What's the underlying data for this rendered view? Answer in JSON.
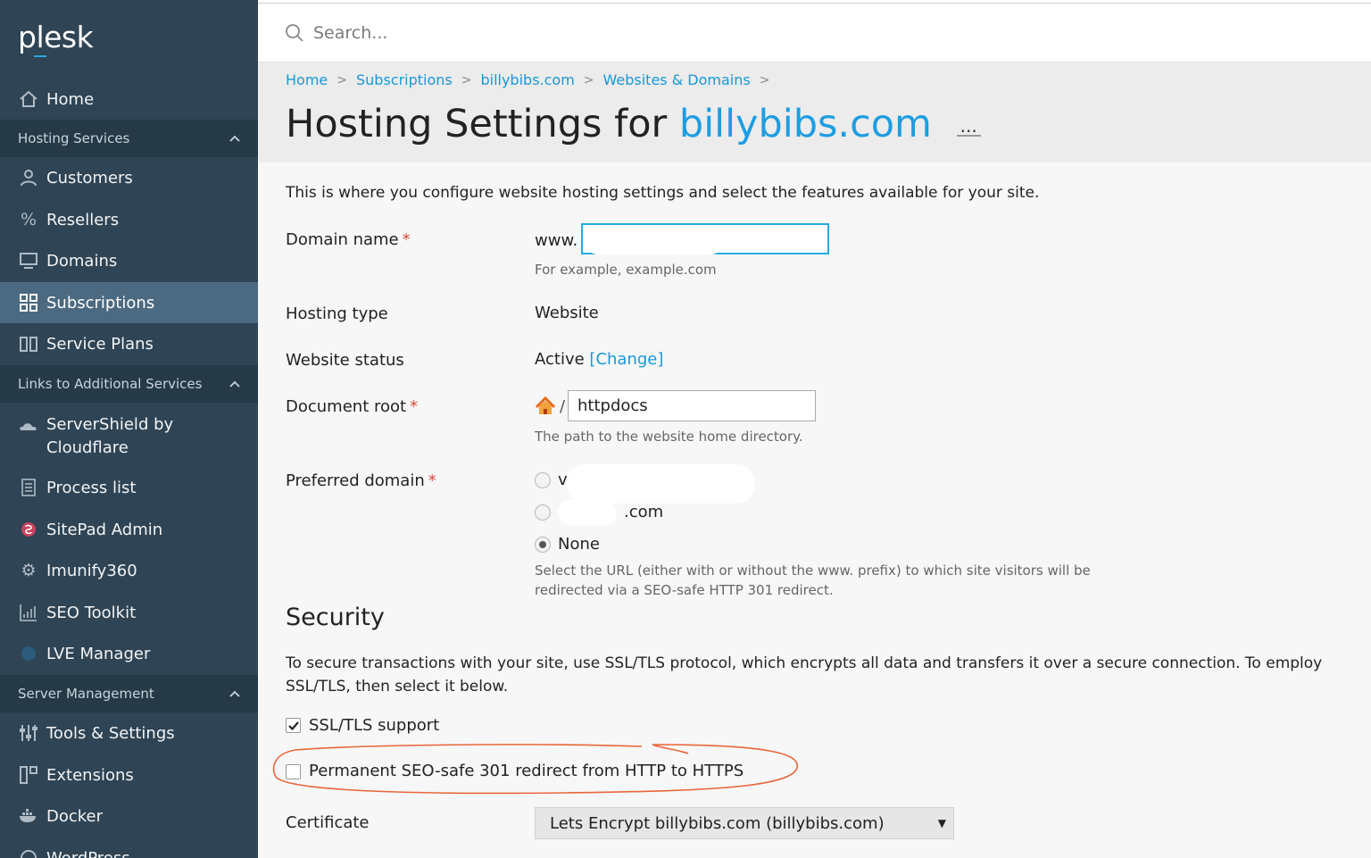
{
  "brand": {
    "logo_text": "plesk"
  },
  "sidebar": {
    "home": "Home",
    "sections": [
      {
        "label": "Hosting Services",
        "chevron": "^"
      },
      {
        "label": "Links to Additional Services",
        "chevron": "^"
      },
      {
        "label": "Server Management",
        "chevron": "^"
      }
    ],
    "hosting_items": [
      {
        "label": "Customers",
        "icon": "user-icon"
      },
      {
        "label": "Resellers",
        "icon": "percent-icon"
      },
      {
        "label": "Domains",
        "icon": "monitor-icon"
      },
      {
        "label": "Subscriptions",
        "icon": "grid-icon",
        "active": true
      },
      {
        "label": "Service Plans",
        "icon": "book-icon"
      }
    ],
    "additional_items": [
      {
        "label": "ServerShield by Cloudflare",
        "icon": "cloud-icon"
      },
      {
        "label": "Process list",
        "icon": "list-icon"
      },
      {
        "label": "SitePad Admin",
        "icon": "sitepad-icon"
      },
      {
        "label": "Imunify360",
        "icon": "gear-icon"
      },
      {
        "label": "SEO Toolkit",
        "icon": "chart-icon"
      },
      {
        "label": "LVE Manager",
        "icon": "lve-icon"
      }
    ],
    "server_items": [
      {
        "label": "Tools & Settings",
        "icon": "sliders-icon"
      },
      {
        "label": "Extensions",
        "icon": "extensions-icon"
      },
      {
        "label": "Docker",
        "icon": "docker-icon"
      },
      {
        "label": "WordPress",
        "icon": "wordpress-icon"
      }
    ]
  },
  "search": {
    "placeholder": "Search..."
  },
  "breadcrumb": [
    "Home",
    "Subscriptions",
    "billybibs.com",
    "Websites & Domains"
  ],
  "page": {
    "title_prefix": "Hosting Settings for",
    "title_domain": "billybibs.com",
    "more": "...",
    "intro": "This is where you configure website hosting settings and select the features available for your site."
  },
  "form": {
    "domain_name": {
      "label": "Domain name",
      "prefix": "www.",
      "value": "",
      "hint": "For example, example.com"
    },
    "hosting_type": {
      "label": "Hosting type",
      "value": "Website"
    },
    "website_status": {
      "label": "Website status",
      "value": "Active",
      "change_link": "[Change]"
    },
    "document_root": {
      "label": "Document root",
      "slash": "/",
      "value": "httpdocs",
      "hint": "The path to the website home directory."
    },
    "preferred_domain": {
      "label": "Preferred domain",
      "options": [
        {
          "label": "v",
          "checked": false
        },
        {
          "label": ".com",
          "checked": false
        },
        {
          "label": "None",
          "checked": true
        }
      ],
      "hint_line1": "Select the URL (either with or without the www. prefix) to which site visitors will be",
      "hint_line2": "redirected via a SEO-safe HTTP 301 redirect."
    }
  },
  "security": {
    "title": "Security",
    "description": "To secure transactions with your site, use SSL/TLS protocol, which encrypts all data and transfers it over a secure connection. To employ SSL/TLS, then select it below.",
    "ssl_support": {
      "label": "SSL/TLS support",
      "checked": true
    },
    "redirect_301": {
      "label": "Permanent SEO-safe 301 redirect from HTTP to HTTPS",
      "checked": false
    },
    "certificate": {
      "label": "Certificate",
      "value": "Lets Encrypt billybibs.com (billybibs.com)"
    }
  },
  "required_mark": "*",
  "colors": {
    "sidebar_bg": "#2f4454",
    "section_bg": "#253947",
    "active_bg": "#4b6a81",
    "link": "#1a98d6",
    "annotation": "#e8663a"
  }
}
